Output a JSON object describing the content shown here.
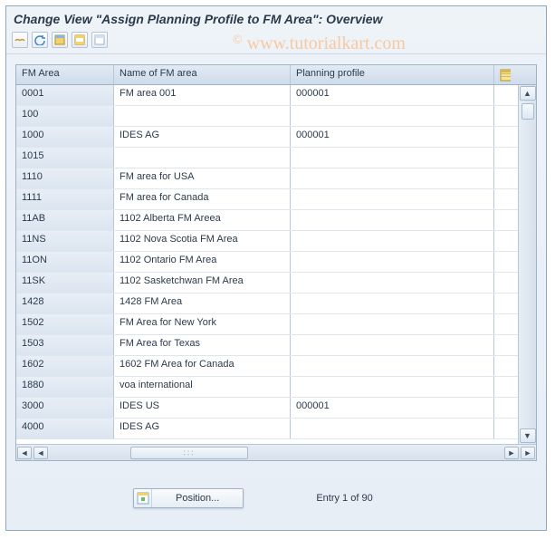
{
  "title": "Change View \"Assign Planning Profile to FM Area\": Overview",
  "watermark": "www.tutorialkart.com",
  "toolbar": {
    "btn1": "other-view-icon",
    "btn2": "undo-icon",
    "btn3": "select-all-icon",
    "btn4": "select-block-icon",
    "btn5": "deselect-all-icon"
  },
  "columns": {
    "fm_area": "FM Area",
    "name": "Name of FM area",
    "profile": "Planning profile",
    "config": "configure-columns-icon"
  },
  "rows": [
    {
      "fm": "0001",
      "name": "FM area 001",
      "pp": "000001"
    },
    {
      "fm": "100",
      "name": "",
      "pp": ""
    },
    {
      "fm": "1000",
      "name": "IDES AG",
      "pp": "000001"
    },
    {
      "fm": "1015",
      "name": "",
      "pp": ""
    },
    {
      "fm": "1110",
      "name": "FM area for USA",
      "pp": ""
    },
    {
      "fm": "1111",
      "name": "FM area for Canada",
      "pp": ""
    },
    {
      "fm": "11AB",
      "name": "1102 Alberta FM Areea",
      "pp": ""
    },
    {
      "fm": "11NS",
      "name": "1102 Nova Scotia FM Area",
      "pp": ""
    },
    {
      "fm": "11ON",
      "name": "1102 Ontario FM Area",
      "pp": ""
    },
    {
      "fm": "11SK",
      "name": "1102 Sasketchwan FM Area",
      "pp": ""
    },
    {
      "fm": "1428",
      "name": "1428 FM Area",
      "pp": ""
    },
    {
      "fm": "1502",
      "name": "FM Area for New York",
      "pp": ""
    },
    {
      "fm": "1503",
      "name": "FM Area for Texas",
      "pp": ""
    },
    {
      "fm": "1602",
      "name": "1602 FM Area for Canada",
      "pp": ""
    },
    {
      "fm": "1880",
      "name": "voa international",
      "pp": ""
    },
    {
      "fm": "3000",
      "name": "IDES US",
      "pp": "000001"
    },
    {
      "fm": "4000",
      "name": "IDES AG",
      "pp": ""
    }
  ],
  "footer": {
    "position_label": "Position...",
    "entry_text": "Entry 1 of 90"
  }
}
